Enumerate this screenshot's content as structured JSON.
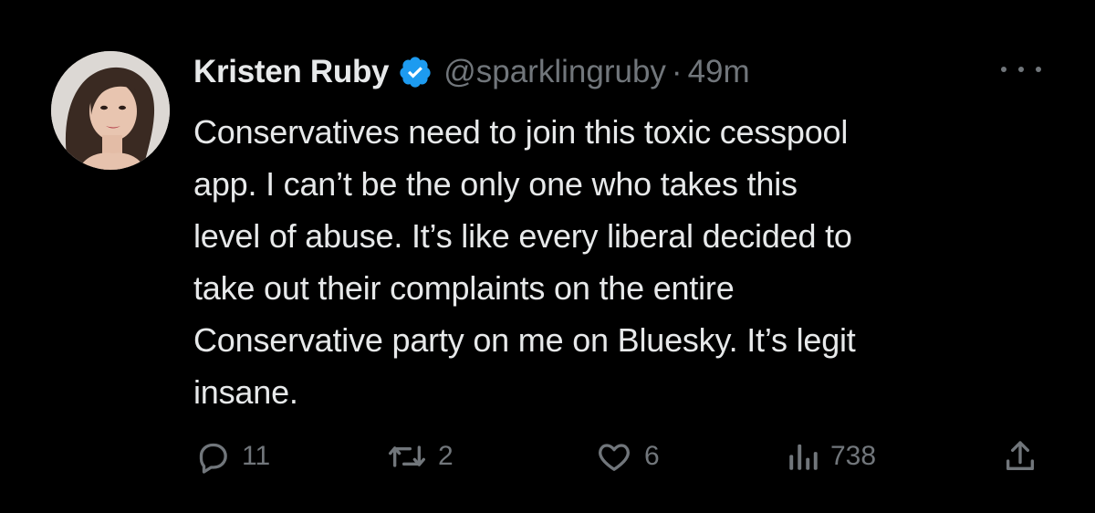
{
  "author": {
    "name": "Kristen Ruby",
    "handle": "@sparklingruby",
    "separator": "·",
    "time": "49m",
    "verified": true,
    "avatar_icon": "profile-photo"
  },
  "tweet": {
    "lines": [
      "Conservatives need to join this toxic cesspool",
      "app. I can’t be the only one who takes this",
      "level of abuse. It’s like every liberal decided to",
      "take out their complaints on the entire",
      "Conservative party on me on Bluesky. It’s legit",
      "insane."
    ]
  },
  "actions": {
    "replies": "11",
    "reposts": "2",
    "likes": "6",
    "views": "738",
    "icons": [
      "reply-icon",
      "repost-icon",
      "like-icon",
      "views-icon",
      "share-icon"
    ]
  },
  "colors": {
    "background": "#000000",
    "text": "#e7e9ea",
    "muted": "#71767b",
    "verified": "#1d9bf0"
  }
}
